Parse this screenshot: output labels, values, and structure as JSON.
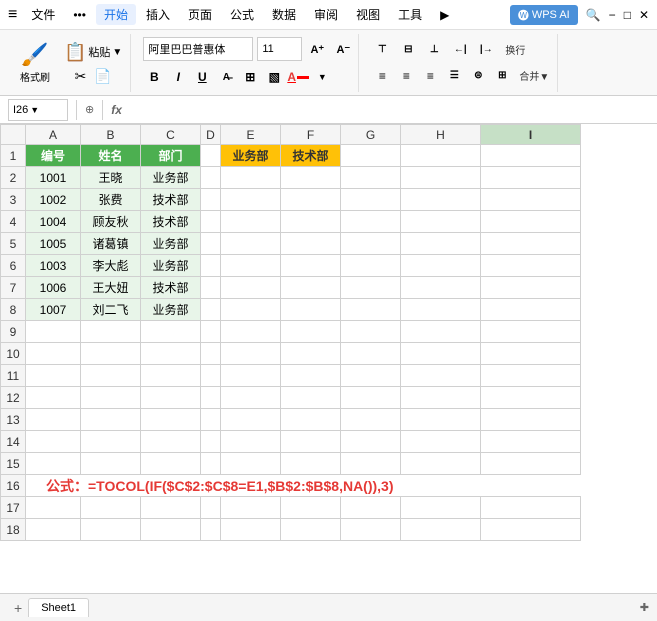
{
  "titlebar": {
    "app_icon": "≡",
    "menu_items": [
      "文件",
      "•••",
      "开始",
      "插入",
      "页面",
      "公式",
      "数据",
      "审阅",
      "视图",
      "工具",
      "▶"
    ],
    "active_menu": "开始",
    "wps_ai_label": "WPS AI",
    "search_icon": "🔍",
    "window_controls": [
      "−",
      "□",
      "✕"
    ]
  },
  "ribbon": {
    "format_label": "格式刷",
    "paste_label": "粘贴",
    "font_name": "阿里巴巴普惠体",
    "font_size": "11",
    "bold": "B",
    "italic": "I",
    "underline": "U",
    "strikethrough": "A̶",
    "border_btn": "⊞",
    "fill_btn": "▧",
    "font_color_btn": "A",
    "align_left": "≡",
    "align_center": "≡",
    "align_right": "≡",
    "align_top": "⊤",
    "align_middle": "⊟",
    "align_bottom": "⊥",
    "wrap_label": "换行",
    "merge_label": "合并▼",
    "increase_font": "A↑",
    "decrease_font": "A↓",
    "indent_decrease": "←|",
    "indent_increase": "|→"
  },
  "formula_bar": {
    "cell_ref": "I26",
    "zoom_icon": "⊕",
    "formula_icon": "fx",
    "formula_value": ""
  },
  "columns": [
    "A",
    "B",
    "C",
    "D",
    "E",
    "F",
    "G",
    "H",
    "I"
  ],
  "rows": [
    1,
    2,
    3,
    4,
    5,
    6,
    7,
    8,
    9,
    10,
    11,
    12,
    13,
    14,
    15,
    16,
    17,
    18
  ],
  "headers": {
    "col_a": "编号",
    "col_b": "姓名",
    "col_c": "部门",
    "col_e": "业务部",
    "col_f": "技术部"
  },
  "data": [
    {
      "row": 2,
      "a": "1001",
      "b": "王晓",
      "c": "业务部"
    },
    {
      "row": 3,
      "a": "1002",
      "b": "张费",
      "c": "技术部"
    },
    {
      "row": 4,
      "a": "1004",
      "b": "顾友秋",
      "c": "技术部"
    },
    {
      "row": 5,
      "a": "1005",
      "b": "诸葛镇",
      "c": "业务部"
    },
    {
      "row": 6,
      "a": "1003",
      "b": "李大彪",
      "c": "业务部"
    },
    {
      "row": 7,
      "a": "1006",
      "b": "王大妞",
      "c": "技术部"
    },
    {
      "row": 8,
      "a": "1007",
      "b": "刘二飞",
      "c": "业务部"
    }
  ],
  "formula_display": "公式：=TOCOL(IF($C$2:$C$8=E1,$B$2:$B$8,NA()),3)",
  "sheet_tab": "Sheet1",
  "status_right": "✚"
}
